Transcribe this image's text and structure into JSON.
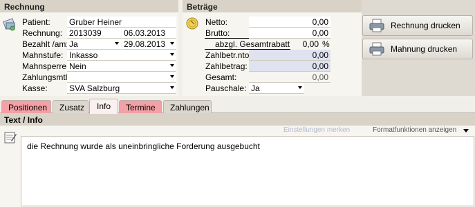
{
  "rechnung": {
    "title": "Rechnung",
    "patient_label": "Patient:",
    "patient_value": "Gruber Heiner",
    "rechnung_label": "Rechnung:",
    "rechnung_nr": "2013039",
    "rechnung_date": "06.03.2013",
    "bezahlt_label": "Bezahlt /am:",
    "bezahlt_value": "Ja",
    "bezahlt_date": "29.08.2013",
    "mahnstufe_label": "Mahnstufe:",
    "mahnstufe_value": "Inkasso",
    "mahnsperre_label": "Mahnsperre:",
    "mahnsperre_value": "Nein",
    "zahlungsmtl_label": "Zahlungsmtl.:",
    "zahlungsmtl_value": "",
    "kasse_label": "Kasse:",
    "kasse_value": "SVA Salzburg"
  },
  "betraege": {
    "title": "Beträge",
    "netto_label": "Netto:",
    "netto_value": "0,00",
    "brutto_label": "Brutto:",
    "brutto_value": "0,00",
    "gesamtrabatt_label": "abzgl. Gesamtrabatt:",
    "gesamtrabatt_value": "0,00",
    "gesamtrabatt_unit": "%",
    "zahlbetr_nto_label": "Zahlbetr.nto.",
    "zahlbetr_nto_value": "0,00",
    "zahlbetrag_label": "Zahlbetrag:",
    "zahlbetrag_value": "0,00",
    "gesamt_label": "Gesamt:",
    "gesamt_value": "0,00",
    "pauschale_label": "Pauschale:",
    "pauschale_value": "Ja"
  },
  "actions": {
    "rechnung_drucken": "Rechnung drucken",
    "mahnung_drucken": "Mahnung drucken"
  },
  "tabs": [
    {
      "label": "Positionen",
      "color": "#f3a0a6"
    },
    {
      "label": "Zusatz",
      "color": "#dcd8d0"
    },
    {
      "label": "Info",
      "color": "#fbf0f0"
    },
    {
      "label": "Termine",
      "color": "#f3a0a6"
    },
    {
      "label": "Zahlungen",
      "color": "#dcd8d0"
    }
  ],
  "info": {
    "section_title": "Text / Info",
    "einstellungen_merken": "Einstellungen merken",
    "formatfunktionen": "Formatfunktionen anzeigen",
    "text": "die Rechnung wurde als uneinbringliche Forderung ausgebucht"
  }
}
